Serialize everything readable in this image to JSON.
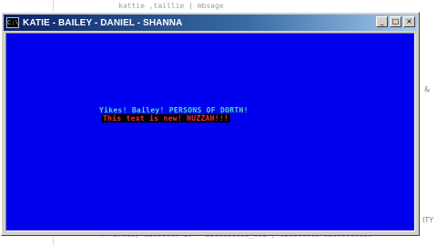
{
  "window": {
    "title": "KATIE - BAILEY - DANIEL - SHANNA",
    "icon": "console-app-icon"
  },
  "caption_buttons": {
    "minimize": "_",
    "maximize": "□",
    "close": "×"
  },
  "console": {
    "background": "#0000ee",
    "line1": "Yikes! Bailey! PERSONS OF DORTH!",
    "line1_color": "#55ddcc",
    "line2": "This text is new! HUZZAH!!!",
    "line2_color": "#ff3030"
  },
  "background_editor": {
    "top_line": "kattie  ,taillie ( mbsage",
    "bottom_line": "' : 'bflle; callltl.  1.    '   10lllllloe_ll1 | lUlllllll-lelllllllll",
    "right_fragment": "& ",
    "right_fragment_2": "ITY"
  }
}
